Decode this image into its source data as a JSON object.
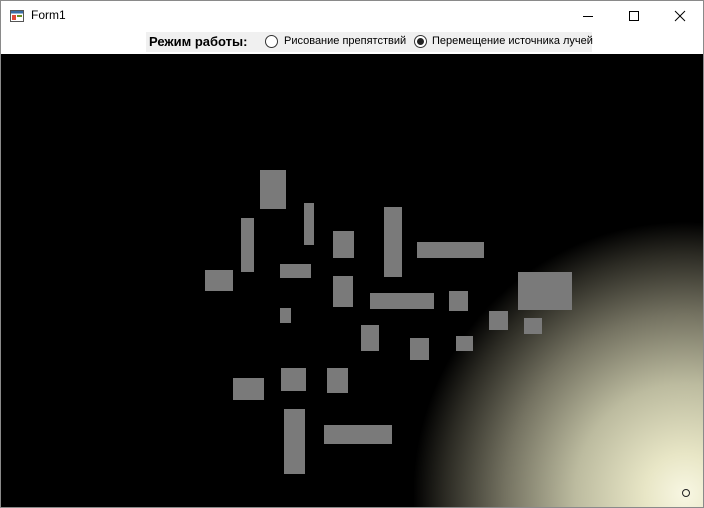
{
  "window": {
    "title": "Form1",
    "app_icon": "form-app-icon"
  },
  "caption_buttons": {
    "minimize": "minimize-icon",
    "maximize": "maximize-icon",
    "close": "close-icon"
  },
  "toolbar": {
    "mode_label": "Режим работы:",
    "options": [
      {
        "label": "Рисование препятствий",
        "selected": false
      },
      {
        "label": "Перемещение источника лучей",
        "selected": true
      }
    ]
  },
  "canvas": {
    "background": "#000000",
    "obstacle_color": "#7a7a7a",
    "light_color": "#f8f7e3"
  }
}
